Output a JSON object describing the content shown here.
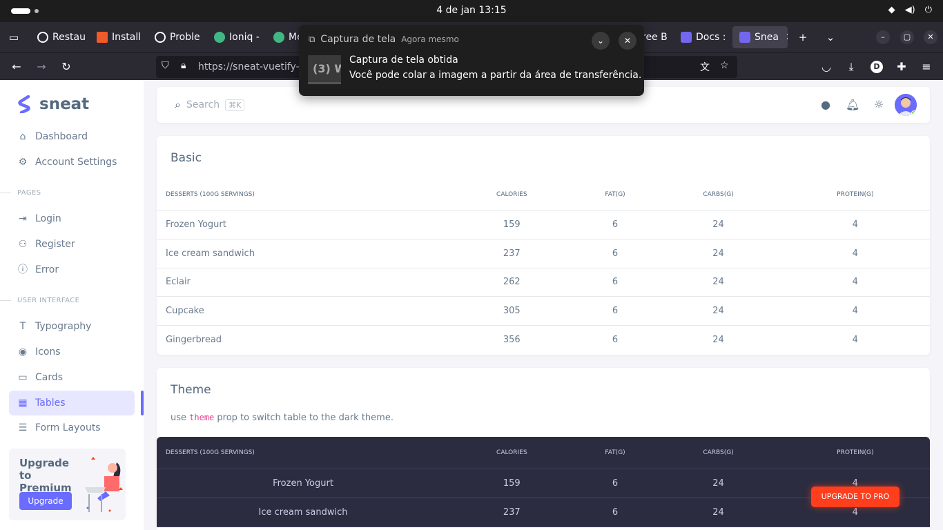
{
  "os": {
    "clock": "4 de jan  13:15"
  },
  "browser": {
    "tabs": [
      {
        "label": "Restau",
        "color": "#ffffff"
      },
      {
        "label": "Install",
        "color": "#f15a29"
      },
      {
        "label": "Proble",
        "color": "#ffffff"
      },
      {
        "label": "Ioniq -",
        "color": "#41b883"
      },
      {
        "label": "Me",
        "color": "#41b883"
      },
      {
        "label": "ree B",
        "color": "#ffffff"
      },
      {
        "label": "Docs :",
        "color": "#7367f0"
      },
      {
        "label": "Snea",
        "color": "#7367f0"
      }
    ],
    "url": "https://sneat-vuetify-",
    "profile_initial": "D"
  },
  "notification": {
    "app": "Captura de tela",
    "time": "Agora mesmo",
    "thumb_text": "(3) W",
    "title": "Captura de tela obtida",
    "body": "Você pode colar a imagem a partir da área de transferência."
  },
  "sidebar": {
    "brand": "sneat",
    "items_top": [
      {
        "label": "Dashboard",
        "icon": "home-icon"
      },
      {
        "label": "Account Settings",
        "icon": "user-cog-icon"
      }
    ],
    "section_pages": "PAGES",
    "items_pages": [
      {
        "label": "Login",
        "icon": "login-icon"
      },
      {
        "label": "Register",
        "icon": "user-plus-icon"
      },
      {
        "label": "Error",
        "icon": "info-circle-icon"
      }
    ],
    "section_ui": "USER INTERFACE",
    "items_ui": [
      {
        "label": "Typography",
        "icon": "typography-icon"
      },
      {
        "label": "Icons",
        "icon": "eye-icon"
      },
      {
        "label": "Cards",
        "icon": "credit-card-icon"
      },
      {
        "label": "Tables",
        "icon": "table-icon"
      },
      {
        "label": "Form Layouts",
        "icon": "form-icon"
      }
    ],
    "upgrade": {
      "title": "Upgrade to Premium",
      "button": "Upgrade"
    }
  },
  "topnav": {
    "search_placeholder": "Search",
    "shortcut": "⌘K"
  },
  "basic": {
    "title": "Basic",
    "headers": [
      "DESSERTS (100G SERVINGS)",
      "CALORIES",
      "FAT(G)",
      "CARBS(G)",
      "PROTEIN(G)"
    ],
    "rows": [
      [
        "Frozen Yogurt",
        "159",
        "6",
        "24",
        "4"
      ],
      [
        "Ice cream sandwich",
        "237",
        "6",
        "24",
        "4"
      ],
      [
        "Eclair",
        "262",
        "6",
        "24",
        "4"
      ],
      [
        "Cupcake",
        "305",
        "6",
        "24",
        "4"
      ],
      [
        "Gingerbread",
        "356",
        "6",
        "24",
        "4"
      ]
    ]
  },
  "theme": {
    "title": "Theme",
    "desc_pre": "use",
    "desc_code": "theme",
    "desc_post": "prop to switch table to the dark theme.",
    "headers": [
      "DESSERTS (100G SERVINGS)",
      "CALORIES",
      "FAT(G)",
      "CARBS(G)",
      "PROTEIN(G)"
    ],
    "rows": [
      [
        "Frozen Yogurt",
        "159",
        "6",
        "24",
        "4"
      ],
      [
        "Ice cream sandwich",
        "237",
        "6",
        "24",
        "4"
      ]
    ]
  },
  "promo": "UPGRADE TO PRO"
}
